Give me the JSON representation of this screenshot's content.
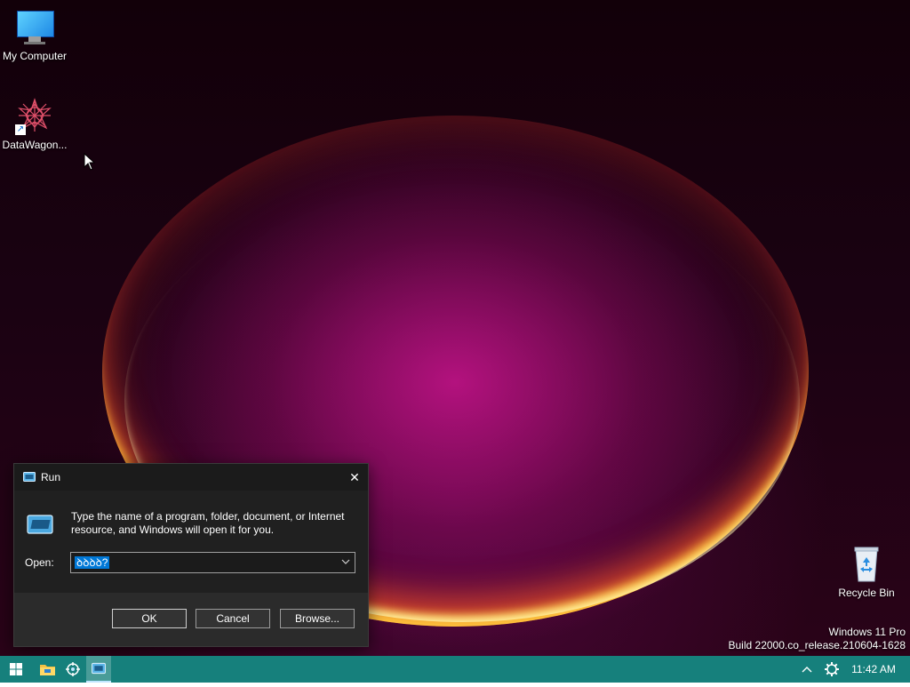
{
  "desktop": {
    "icons": [
      {
        "label": "My Computer",
        "icon": "monitor-icon"
      },
      {
        "label": "DataWagon...",
        "icon": "datawagon-icon"
      },
      {
        "label": "Recycle Bin",
        "icon": "recycle-bin-icon"
      }
    ],
    "watermark": {
      "line1": "Windows 11 Pro",
      "line2": "Build 22000.co_release.210604-1628"
    }
  },
  "run_dialog": {
    "title": "Run",
    "description": "Type the name of a program, folder, document, or Internet resource, and Windows will open it for you.",
    "open_label": "Open:",
    "open_value": "ꝺꝺꝺꝺ?",
    "buttons": {
      "ok": "OK",
      "cancel": "Cancel",
      "browse": "Browse..."
    }
  },
  "taskbar": {
    "items": [
      "windows-start-icon",
      "file-explorer-icon",
      "app-icon",
      "run-icon"
    ],
    "tray": [
      "chevron-up-icon",
      "gear-icon"
    ],
    "clock": "11:42 AM"
  },
  "colors": {
    "taskbar": "#16807c",
    "selection": "#0078d7",
    "dialog_bg": "#202020"
  }
}
